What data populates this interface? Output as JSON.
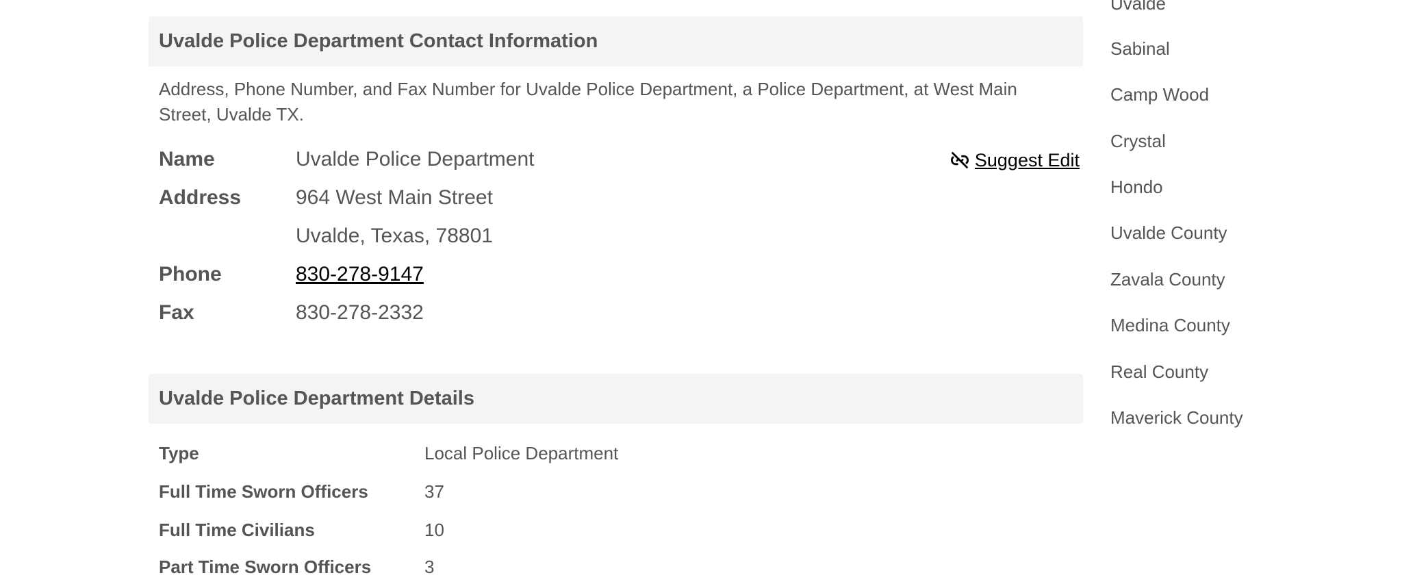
{
  "contact": {
    "heading": "Uvalde Police Department Contact Information",
    "description": "Address, Phone Number, and Fax Number for Uvalde Police Department, a Police Department, at West Main Street, Uvalde TX.",
    "suggest_edit": "Suggest Edit",
    "name_label": "Name",
    "name_value": "Uvalde Police Department",
    "address_label": "Address",
    "address_line1": "964 West Main Street",
    "address_line2": "Uvalde, Texas, 78801",
    "phone_label": "Phone",
    "phone_value": "830-278-9147",
    "fax_label": "Fax",
    "fax_value": "830-278-2332"
  },
  "details": {
    "heading": "Uvalde Police Department Details",
    "rows": [
      {
        "label": "Type",
        "value": "Local Police Department"
      },
      {
        "label": "Full Time Sworn Officers",
        "value": "37"
      },
      {
        "label": "Full Time Civilians",
        "value": "10"
      },
      {
        "label": "Part Time Sworn Officers",
        "value": "3"
      }
    ]
  },
  "sidebar": {
    "items": [
      "Uvalde",
      "Sabinal",
      "Camp Wood",
      "Crystal",
      "Hondo",
      "Uvalde County",
      "Zavala County",
      "Medina County",
      "Real County",
      "Maverick County"
    ]
  },
  "icons": {
    "suggest_edit_icon": "unlink-icon"
  }
}
